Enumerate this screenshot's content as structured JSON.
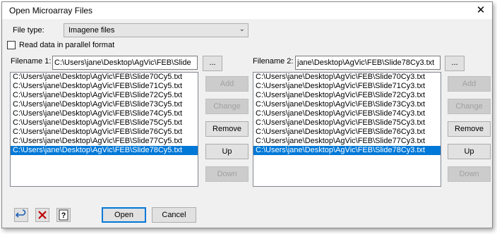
{
  "window": {
    "title": "Open Microarray Files"
  },
  "file_type": {
    "label": "File type:",
    "value": "Imagene files"
  },
  "parallel": {
    "label": "Read data in parallel format",
    "checked": false
  },
  "left": {
    "filename_label": "Filename 1:",
    "filename_value": "C:\\Users\\jane\\Desktop\\AgVic\\FEB\\Slide",
    "browse_label": "...",
    "items": [
      "C:\\Users\\jane\\Desktop\\AgVic\\FEB\\Slide70Cy5.txt",
      "C:\\Users\\jane\\Desktop\\AgVic\\FEB\\Slide71Cy5.txt",
      "C:\\Users\\jane\\Desktop\\AgVic\\FEB\\Slide72Cy5.txt",
      "C:\\Users\\jane\\Desktop\\AgVic\\FEB\\Slide73Cy5.txt",
      "C:\\Users\\jane\\Desktop\\AgVic\\FEB\\Slide74Cy5.txt",
      "C:\\Users\\jane\\Desktop\\AgVic\\FEB\\Slide75Cy5.txt",
      "C:\\Users\\jane\\Desktop\\AgVic\\FEB\\Slide76Cy5.txt",
      "C:\\Users\\jane\\Desktop\\AgVic\\FEB\\Slide77Cy5.txt",
      "C:\\Users\\jane\\Desktop\\AgVic\\FEB\\Slide78Cy5.txt"
    ],
    "selected_index": 8
  },
  "right": {
    "filename_label": "Filename 2:",
    "filename_value": "jane\\Desktop\\AgVic\\FEB\\Slide78Cy3.txt",
    "browse_label": "...",
    "items": [
      "C:\\Users\\jane\\Desktop\\AgVic\\FEB\\Slide70Cy3.txt",
      "C:\\Users\\jane\\Desktop\\AgVic\\FEB\\Slide71Cy3.txt",
      "C:\\Users\\jane\\Desktop\\AgVic\\FEB\\Slide72Cy3.txt",
      "C:\\Users\\jane\\Desktop\\AgVic\\FEB\\Slide73Cy3.txt",
      "C:\\Users\\jane\\Desktop\\AgVic\\FEB\\Slide74Cy3.txt",
      "C:\\Users\\jane\\Desktop\\AgVic\\FEB\\Slide75Cy3.txt",
      "C:\\Users\\jane\\Desktop\\AgVic\\FEB\\Slide76Cy3.txt",
      "C:\\Users\\jane\\Desktop\\AgVic\\FEB\\Slide77Cy3.txt",
      "C:\\Users\\jane\\Desktop\\AgVic\\FEB\\Slide78Cy3.txt"
    ],
    "selected_index": 8
  },
  "buttons": {
    "add": "Add",
    "change": "Change",
    "remove": "Remove",
    "up": "Up",
    "down": "Down",
    "open": "Open",
    "cancel": "Cancel"
  },
  "icons": {
    "undo": "undo-icon",
    "clear": "clear-x-icon",
    "help": "help-icon",
    "close": "close-icon"
  },
  "colors": {
    "selection": "#0078d7",
    "default_button_border": "#0078d7",
    "clear_icon": "#c00000",
    "undo_icon": "#1a5fb4"
  }
}
